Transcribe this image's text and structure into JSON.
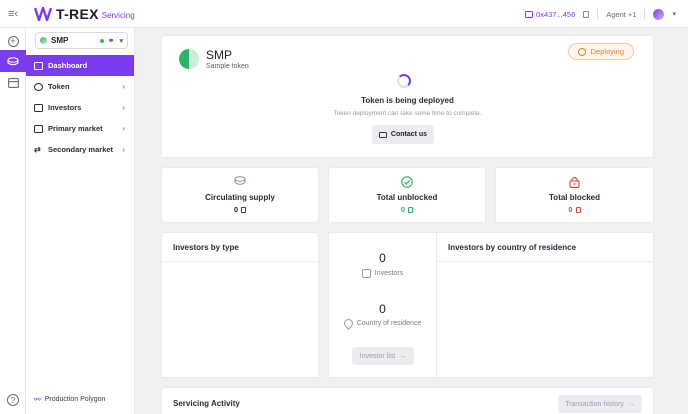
{
  "app": {
    "brand": "T-REX",
    "product": "Servicing"
  },
  "header": {
    "wallet": "0x437...456",
    "role": "Agent +1"
  },
  "sidebar": {
    "token": {
      "name": "SMP"
    },
    "items": [
      {
        "label": "Dashboard",
        "icon": "grid-icon",
        "active": true
      },
      {
        "label": "Token",
        "icon": "coin-icon",
        "active": false
      },
      {
        "label": "Investors",
        "icon": "user-card-icon",
        "active": false
      },
      {
        "label": "Primary market",
        "icon": "tag-icon",
        "active": false
      },
      {
        "label": "Secondary market",
        "icon": "swap-icon",
        "active": false
      }
    ],
    "footer": "Production Polygon"
  },
  "hero": {
    "token_name": "SMP",
    "token_description": "Sample token",
    "status_badge": "Deploying",
    "title": "Token is being deployed",
    "description": "Token deployment can take some time to complete.",
    "contact_label": "Contact us"
  },
  "stats": [
    {
      "label": "Circulating supply",
      "value": "0",
      "icon": "coins-icon",
      "color": "#1d1d2b"
    },
    {
      "label": "Total unblocked",
      "value": "0",
      "icon": "check-circle-icon",
      "color": "#2eb26a"
    },
    {
      "label": "Total blocked",
      "value": "0",
      "icon": "lock-icon",
      "color": "#d64545"
    }
  ],
  "investors": {
    "by_type_title": "Investors by type",
    "investors_count": "0",
    "investors_label": "Investors",
    "countries_count": "0",
    "countries_label": "Country of residence",
    "list_button": "Investor list",
    "by_country_title": "Investors by country of residence"
  },
  "activity": {
    "title": "Servicing Activity",
    "history_button": "Transaction history"
  },
  "colors": {
    "accent": "#7a3cf0",
    "warning": "#d9822b",
    "success": "#2eb26a",
    "danger": "#d64545"
  }
}
